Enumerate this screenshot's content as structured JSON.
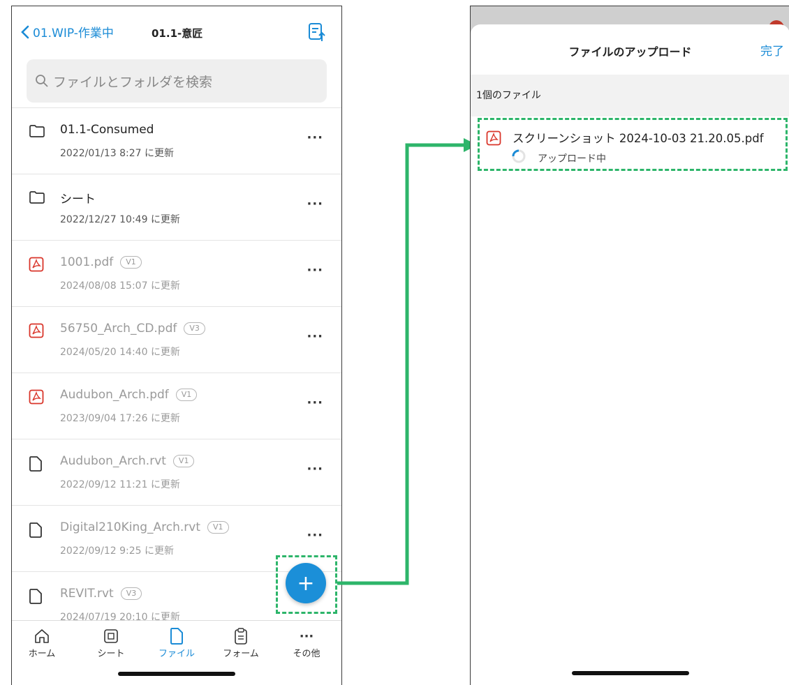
{
  "left": {
    "back_label": "01.WIP-作業中",
    "folder_title": "01.1-意匠",
    "search_placeholder": "ファイルとフォルダを検索",
    "items": [
      {
        "name": "01.1-Consumed",
        "date": "2022/01/13 8:27 に更新",
        "type": "folder"
      },
      {
        "name": "シート",
        "date": "2022/12/27 10:49 に更新",
        "type": "folder"
      },
      {
        "name": "1001.pdf",
        "version": "V1",
        "date": "2024/08/08 15:07 に更新",
        "type": "pdf"
      },
      {
        "name": "56750_Arch_CD.pdf",
        "version": "V3",
        "date": "2024/05/20 14:40 に更新",
        "type": "pdf"
      },
      {
        "name": "Audubon_Arch.pdf",
        "version": "V1",
        "date": "2023/09/04 17:26 に更新",
        "type": "pdf"
      },
      {
        "name": "Audubon_Arch.rvt",
        "version": "V1",
        "date": "2022/09/12 11:21 に更新",
        "type": "file"
      },
      {
        "name": "Digital210King_Arch.rvt",
        "version": "V1",
        "date": "2022/09/12 9:25 に更新",
        "type": "file"
      },
      {
        "name": "REVIT.rvt",
        "version": "V3",
        "date": "2024/07/19 20:10 に更新",
        "type": "file"
      }
    ],
    "more_label": "···",
    "fab_label": "+",
    "tabs": [
      {
        "label": "ホーム",
        "icon": "home-icon"
      },
      {
        "label": "シート",
        "icon": "sheet-icon"
      },
      {
        "label": "ファイル",
        "icon": "file-icon"
      },
      {
        "label": "フォーム",
        "icon": "form-icon"
      },
      {
        "label": "その他",
        "icon": "more-icon"
      }
    ],
    "active_tab": "ファイル"
  },
  "right": {
    "title": "ファイルのアップロード",
    "done_label": "完了",
    "section_label": "1個のファイル",
    "upload": {
      "name": "スクリーンショット 2024-10-03 21.20.05.pdf",
      "status": "アップロード中"
    }
  },
  "colors": {
    "accent": "#1a8bd6",
    "highlight": "#2db56a",
    "pdf": "#d9352a"
  }
}
